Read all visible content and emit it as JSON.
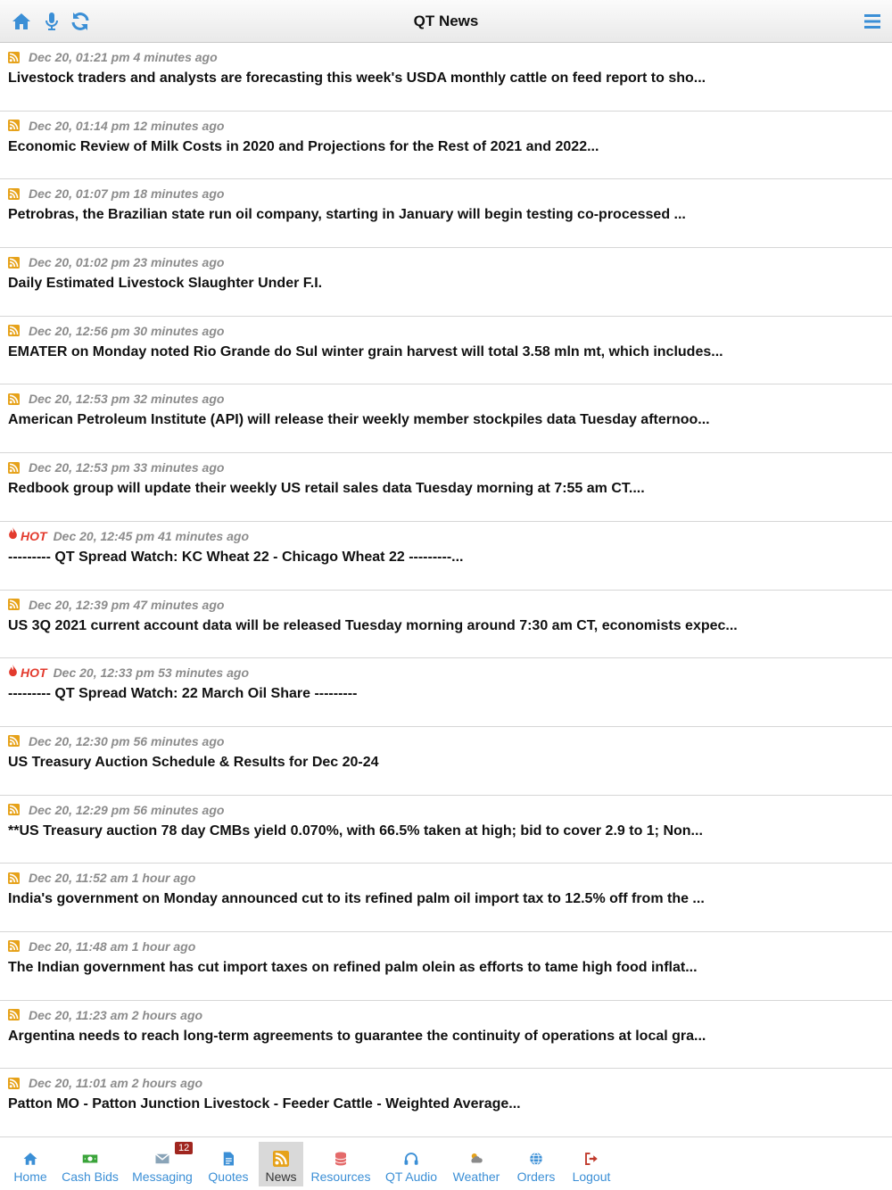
{
  "header": {
    "title": "QT News",
    "icons": {
      "home": "home-icon",
      "mic": "microphone-icon",
      "refresh": "refresh-icon",
      "menu": "hamburger-menu-icon"
    }
  },
  "colors": {
    "accent": "#3b8fd6",
    "rss": "#e6a21a",
    "hot": "#e33b2e",
    "badge": "#a0261f"
  },
  "news": [
    {
      "type": "rss",
      "time": "Dec 20, 01:21 pm 4 minutes ago",
      "headline": "Livestock traders and analysts are forecasting this week's USDA monthly cattle on feed report to sho..."
    },
    {
      "type": "rss",
      "time": "Dec 20, 01:14 pm 12 minutes ago",
      "headline": "Economic Review of Milk Costs in 2020 and Projections for the Rest of 2021 and 2022..."
    },
    {
      "type": "rss",
      "time": "Dec 20, 01:07 pm 18 minutes ago",
      "headline": "Petrobras, the Brazilian state run oil company, starting in January will begin testing co-processed ..."
    },
    {
      "type": "rss",
      "time": "Dec 20, 01:02 pm 23 minutes ago",
      "headline": "Daily Estimated Livestock Slaughter Under F.I."
    },
    {
      "type": "rss",
      "time": "Dec 20, 12:56 pm 30 minutes ago",
      "headline": "EMATER on Monday noted Rio Grande do Sul winter grain harvest will total 3.58 mln mt, which includes..."
    },
    {
      "type": "rss",
      "time": "Dec 20, 12:53 pm 32 minutes ago",
      "headline": "American Petroleum Institute (API) will release their weekly member stockpiles data Tuesday afternoo..."
    },
    {
      "type": "rss",
      "time": "Dec 20, 12:53 pm 33 minutes ago",
      "headline": "Redbook group will update their weekly US retail sales data Tuesday morning at 7:55 am CT...."
    },
    {
      "type": "hot",
      "hot_label": "HOT",
      "time": "Dec 20, 12:45 pm 41 minutes ago",
      "headline": "--------- QT Spread Watch: KC Wheat 22 - Chicago Wheat 22 ---------..."
    },
    {
      "type": "rss",
      "time": "Dec 20, 12:39 pm 47 minutes ago",
      "headline": "US 3Q 2021 current account data will be released Tuesday morning around 7:30 am CT, economists expec..."
    },
    {
      "type": "hot",
      "hot_label": "HOT",
      "time": "Dec 20, 12:33 pm 53 minutes ago",
      "headline": "--------- QT Spread Watch: 22 March Oil Share ---------"
    },
    {
      "type": "rss",
      "time": "Dec 20, 12:30 pm 56 minutes ago",
      "headline": "US Treasury Auction Schedule & Results for Dec 20-24"
    },
    {
      "type": "rss",
      "time": "Dec 20, 12:29 pm 56 minutes ago",
      "headline": "**US Treasury auction 78 day CMBs yield 0.070%, with 66.5% taken at high; bid to cover 2.9 to 1; Non..."
    },
    {
      "type": "rss",
      "time": "Dec 20, 11:52 am 1 hour ago",
      "headline": "India's government on Monday announced cut to its refined palm oil import tax to 12.5% off from the ..."
    },
    {
      "type": "rss",
      "time": "Dec 20, 11:48 am 1 hour ago",
      "headline": "The Indian government has cut import taxes on refined palm olein as efforts to tame high food inflat..."
    },
    {
      "type": "rss",
      "time": "Dec 20, 11:23 am 2 hours ago",
      "headline": "Argentina needs to reach long-term agreements to guarantee the continuity of operations at local gra..."
    },
    {
      "type": "rss",
      "time": "Dec 20, 11:01 am 2 hours ago",
      "headline": "Patton MO - Patton Junction Livestock - Feeder Cattle - Weighted Average..."
    }
  ],
  "tabbar": {
    "active": "News",
    "messaging_badge": "12",
    "tabs": [
      {
        "label": "Home",
        "icon": "home-icon"
      },
      {
        "label": "Cash Bids",
        "icon": "cash-icon"
      },
      {
        "label": "Messaging",
        "icon": "envelope-icon"
      },
      {
        "label": "Quotes",
        "icon": "document-icon"
      },
      {
        "label": "News",
        "icon": "rss-icon"
      },
      {
        "label": "Resources",
        "icon": "database-icon"
      },
      {
        "label": "QT Audio",
        "icon": "headphones-icon"
      },
      {
        "label": "Weather",
        "icon": "weather-icon"
      },
      {
        "label": "Orders",
        "icon": "globe-icon"
      },
      {
        "label": "Logout",
        "icon": "logout-icon"
      }
    ]
  }
}
